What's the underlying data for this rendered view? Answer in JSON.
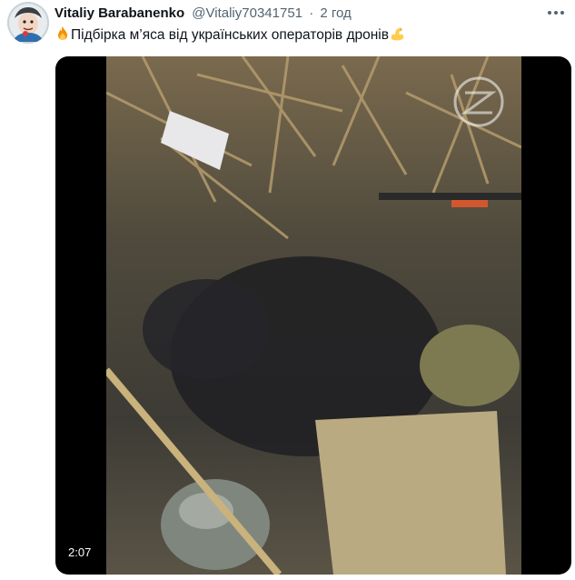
{
  "author": {
    "display_name": "Vitaliy Barabanenko",
    "handle": "@Vitaliy70341751",
    "separator": "·",
    "time": "2 год"
  },
  "tweet": {
    "text": "Підбірка м’яса від українських операторів дронів",
    "leading_emoji": "fire-icon",
    "trailing_emoji": "flexed-biceps-icon"
  },
  "media": {
    "duration": "2:07"
  }
}
